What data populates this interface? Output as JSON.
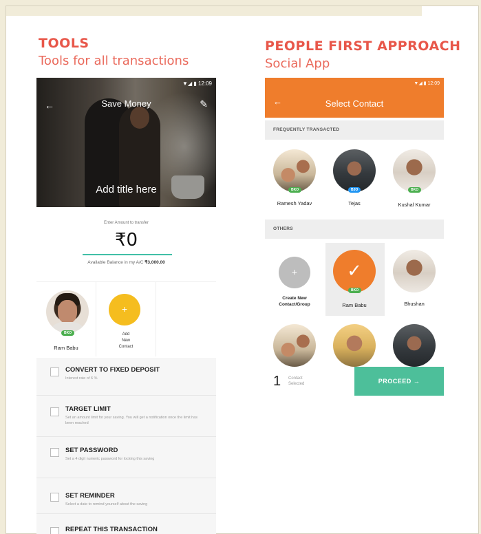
{
  "left_section": {
    "title": "TOOLS",
    "subtitle": "Tools for all transactions"
  },
  "right_section": {
    "title": "PEOPLE FIRST APPROACH",
    "subtitle": "Social App"
  },
  "tools_screen": {
    "status_time": "12:09",
    "header_title": "Save Money",
    "add_title_placeholder": "Add title here",
    "amount_hint": "Enter Amount to transfer",
    "amount": "₹0",
    "balance_label": "Available Balance in my A/C",
    "balance_value": "₹3,000.00",
    "contact_card": {
      "name": "Ram Babu",
      "badge": "BKO"
    },
    "add_card": {
      "label_lines": [
        "Add",
        "New",
        "Contact"
      ],
      "symbol": "+"
    },
    "options": [
      {
        "title": "CONVERT TO FIXED DEPOSIT",
        "description": "Interest rate of 6 %"
      },
      {
        "title": "TARGET LIMIT",
        "description": "Set an amount limit for your saving. You will get a notification once the limit has been reached"
      },
      {
        "title": "SET PASSWORD",
        "description": "Set a 4 digit numeric password for locking this saving"
      },
      {
        "title": "SET REMINDER",
        "description": "Select a date to remind yourself about the saving"
      },
      {
        "title": "REPEAT THIS TRANSACTION",
        "description": ""
      }
    ]
  },
  "social_screen": {
    "status_time": "12:09",
    "header_title": "Select Contact",
    "frequent_label": "FREQUENTLY TRANSACTED",
    "frequent": [
      {
        "name": "Ramesh Yadav",
        "badge": "BKO",
        "badge_color": "green"
      },
      {
        "name": "Tejas",
        "badge": "BJO",
        "badge_color": "blue"
      },
      {
        "name": "Kushal Kumar",
        "badge": "BKO",
        "badge_color": "green"
      }
    ],
    "others_label": "OTHERS",
    "create_new_label_lines": [
      "Create New",
      "Contact/Group"
    ],
    "create_symbol": "+",
    "others": [
      {
        "name": "Ram Babu",
        "badge": "BKO",
        "selected": true
      },
      {
        "name": "Bhushan"
      }
    ],
    "selected_count": "1",
    "selected_label_lines": [
      "Contact",
      "Selected"
    ],
    "proceed_label": "PROCEED →"
  }
}
